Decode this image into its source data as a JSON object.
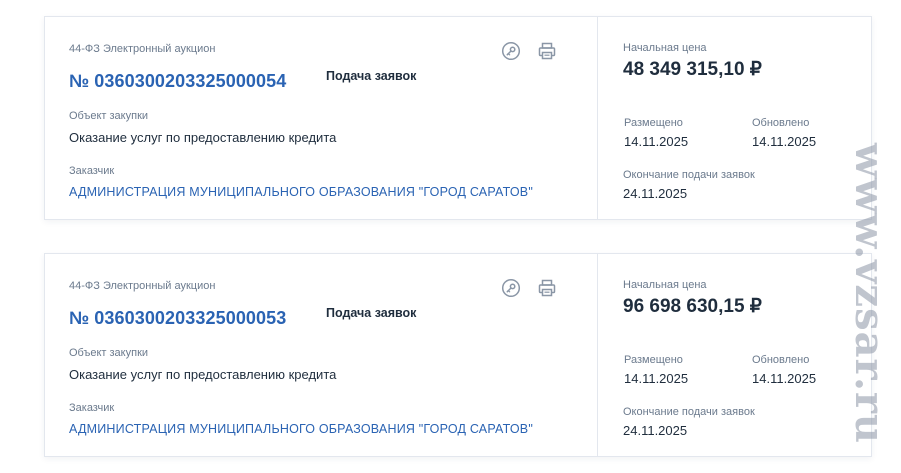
{
  "cards": [
    {
      "procurement_type": "44-ФЗ Электронный аукцион",
      "number": "№ 0360300203325000054",
      "status": "Подача заявок",
      "object_label": "Объект закупки",
      "object": "Оказание услуг по предоставлению кредита",
      "customer_label": "Заказчик",
      "customer": "АДМИНИСТРАЦИЯ МУНИЦИПАЛЬНОГО ОБРАЗОВАНИЯ \"ГОРОД САРАТОВ\"",
      "price_label": "Начальная цена",
      "price": "48 349 315,10 ₽",
      "posted_label": "Размещено",
      "posted": "14.11.2025",
      "updated_label": "Обновлено",
      "updated": "14.11.2025",
      "end_label": "Окончание подачи заявок",
      "end": "24.11.2025"
    },
    {
      "procurement_type": "44-ФЗ Электронный аукцион",
      "number": "№ 0360300203325000053",
      "status": "Подача заявок",
      "object_label": "Объект закупки",
      "object": "Оказание услуг по предоставлению кредита",
      "customer_label": "Заказчик",
      "customer": "АДМИНИСТРАЦИЯ МУНИЦИПАЛЬНОГО ОБРАЗОВАНИЯ \"ГОРОД САРАТОВ\"",
      "price_label": "Начальная цена",
      "price": "96 698 630,15 ₽",
      "posted_label": "Размещено",
      "posted": "14.11.2025",
      "updated_label": "Обновлено",
      "updated": "14.11.2025",
      "end_label": "Окончание подачи заявок",
      "end": "24.11.2025"
    }
  ],
  "icons": {
    "key": "key-icon",
    "print": "printer-icon"
  },
  "colors": {
    "link": "#2a63b3",
    "text": "#1f2d3d",
    "muted": "#6b7a8d",
    "icon": "#8a96a6"
  },
  "watermark": "www.vzsar.ru"
}
